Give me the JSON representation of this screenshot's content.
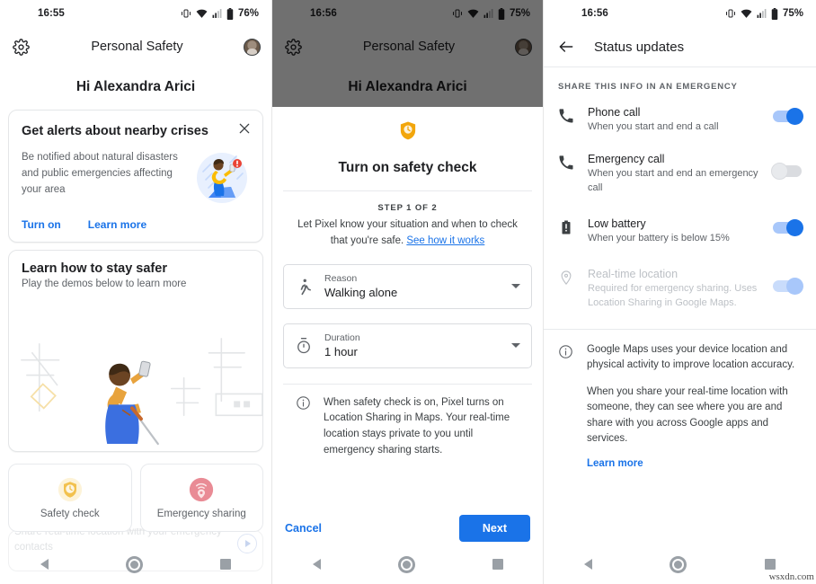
{
  "screen1": {
    "status": {
      "time": "16:55",
      "battery": "76%",
      "icons": [
        "vibrate-icon",
        "wifi-icon",
        "signal-icon",
        "battery-icon"
      ]
    },
    "appbar": {
      "settings_icon": "gear-icon",
      "title": "Personal Safety",
      "avatar": "account-avatar"
    },
    "greeting": "Hi Alexandra Arici",
    "alert_card": {
      "title": "Get alerts about nearby crises",
      "close_icon": "close-icon",
      "description": "Be notified about natural disasters and public emergencies affecting your area",
      "illustration": "person-with-phone-alert-illustration",
      "primary_link": "Turn on",
      "secondary_link": "Learn more"
    },
    "demo_card": {
      "title": "Learn how to stay safer",
      "subtitle": "Play the demos below to learn more",
      "illustration": "person-taking-photo-illustration"
    },
    "tiles": [
      {
        "icon": "safety-check-shield-clock-icon",
        "label": "Safety check",
        "color": "#f9cf6a"
      },
      {
        "icon": "emergency-sharing-location-icon",
        "label": "Emergency sharing",
        "color": "#e4808a"
      }
    ],
    "ghost_text": "Share real-time location with your emergency contacts",
    "play_icon": "play-circle-icon"
  },
  "screen2": {
    "status": {
      "time": "16:56",
      "battery": "75%"
    },
    "appbar": {
      "settings_icon": "gear-icon",
      "title": "Personal Safety",
      "avatar": "account-avatar"
    },
    "greeting": "Hi Alexandra Arici",
    "sheet": {
      "hero_icon": "shield-clock-icon",
      "title": "Turn on safety check",
      "step": "STEP 1 OF 2",
      "step_desc": "Let Pixel know your situation and when to check that you're safe. ",
      "step_link": "See how it works",
      "fields": [
        {
          "icon": "walking-person-icon",
          "label": "Reason",
          "value": "Walking alone",
          "caret": "chevron-down-icon"
        },
        {
          "icon": "stopwatch-icon",
          "label": "Duration",
          "value": "1 hour",
          "caret": "chevron-down-icon"
        }
      ],
      "note_icon": "info-icon",
      "note": "When safety check is on, Pixel turns on Location Sharing in Maps. Your real-time location stays private to you until emergency sharing starts.",
      "cancel_label": "Cancel",
      "next_label": "Next"
    }
  },
  "screen3": {
    "status": {
      "time": "16:56",
      "battery": "75%"
    },
    "appbar": {
      "back_icon": "arrow-back-icon",
      "title": "Status updates"
    },
    "section_header": "SHARE THIS INFO IN AN EMERGENCY",
    "rows": [
      {
        "icon": "phone-icon",
        "title": "Phone call",
        "subtitle": "When you start and end a call",
        "toggle": "on",
        "disabled": false
      },
      {
        "icon": "phone-icon",
        "title": "Emergency call",
        "subtitle": "When you start and end an emergency call",
        "toggle": "off",
        "disabled": false
      },
      {
        "icon": "battery-alert-icon",
        "title": "Low battery",
        "subtitle": "When your battery is below 15%",
        "toggle": "on",
        "disabled": false
      },
      {
        "icon": "location-pin-icon",
        "title": "Real-time location",
        "subtitle": "Required for emergency sharing. Uses Location Sharing in Google Maps.",
        "toggle": "on-dim",
        "disabled": true
      }
    ],
    "info": {
      "icon": "info-icon",
      "paragraph1": "Google Maps uses your device location and physical activity to improve location accuracy.",
      "paragraph2": "When you share your real-time location with someone, they can see where you are and share with you across Google apps and services.",
      "link": "Learn more"
    }
  },
  "navbar": {
    "back": "nav-back-icon",
    "home": "nav-home-icon",
    "recents": "nav-recents-icon"
  },
  "watermark": "wsxdn.com",
  "colors": {
    "accent": "#1a73e8",
    "text": "#202124",
    "muted": "#5f6368",
    "divider": "#e8eaed",
    "yellow": "#f9cf6a",
    "red": "#e4808a"
  }
}
